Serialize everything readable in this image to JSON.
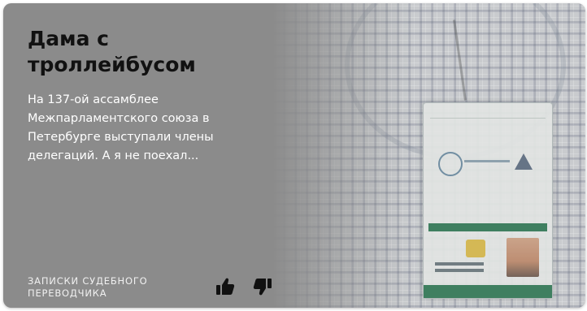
{
  "card": {
    "title": "Дама с троллейбусом",
    "excerpt": "На 137-ой ассамблее Межпарламентского союза в Петербурге выступали члены делегаций. А я не поехал...",
    "source": "ЗАПИСКИ СУДЕБНОГО ПЕРЕВОДЧИКА",
    "background_color": "#8b8b8b",
    "title_color": "#111111",
    "text_color": "#ffffff"
  },
  "actions": {
    "like_icon": "thumb-up-icon",
    "dislike_icon": "thumb-down-icon"
  }
}
